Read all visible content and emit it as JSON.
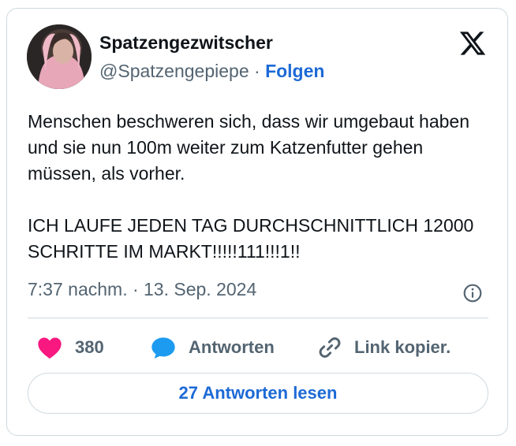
{
  "tweet": {
    "display_name": "Spatzengezwitscher",
    "handle": "@Spatzengepiepe",
    "separator": " · ",
    "follow_label": "Folgen",
    "paragraphs": [
      "Menschen beschweren sich, dass wir umgebaut haben und sie nun 100m weiter zum Katzenfutter gehen müssen, als vorher.",
      "ICH LAUFE JEDEN TAG DURCHSCHNITTLICH 12000 SCHRITTE IM MARKT!!!!!111!!!1!!"
    ],
    "timestamp": "7:37 nachm. · 13. Sep. 2024"
  },
  "actions": {
    "like_count": "380",
    "reply_label": "Antworten",
    "copy_link_label": "Link kopier."
  },
  "read_replies_label": "27 Antworten lesen",
  "icons": {
    "avatar": "profile-photo",
    "brand": "x-logo-icon",
    "info": "info-icon",
    "like": "heart-icon",
    "reply": "speech-bubble-icon",
    "link": "link-icon"
  },
  "colors": {
    "like": "#f91880",
    "reply": "#1d9bf0",
    "link_text": "#1d6ad6",
    "secondary_text": "#536471",
    "border": "#cfd9de"
  }
}
